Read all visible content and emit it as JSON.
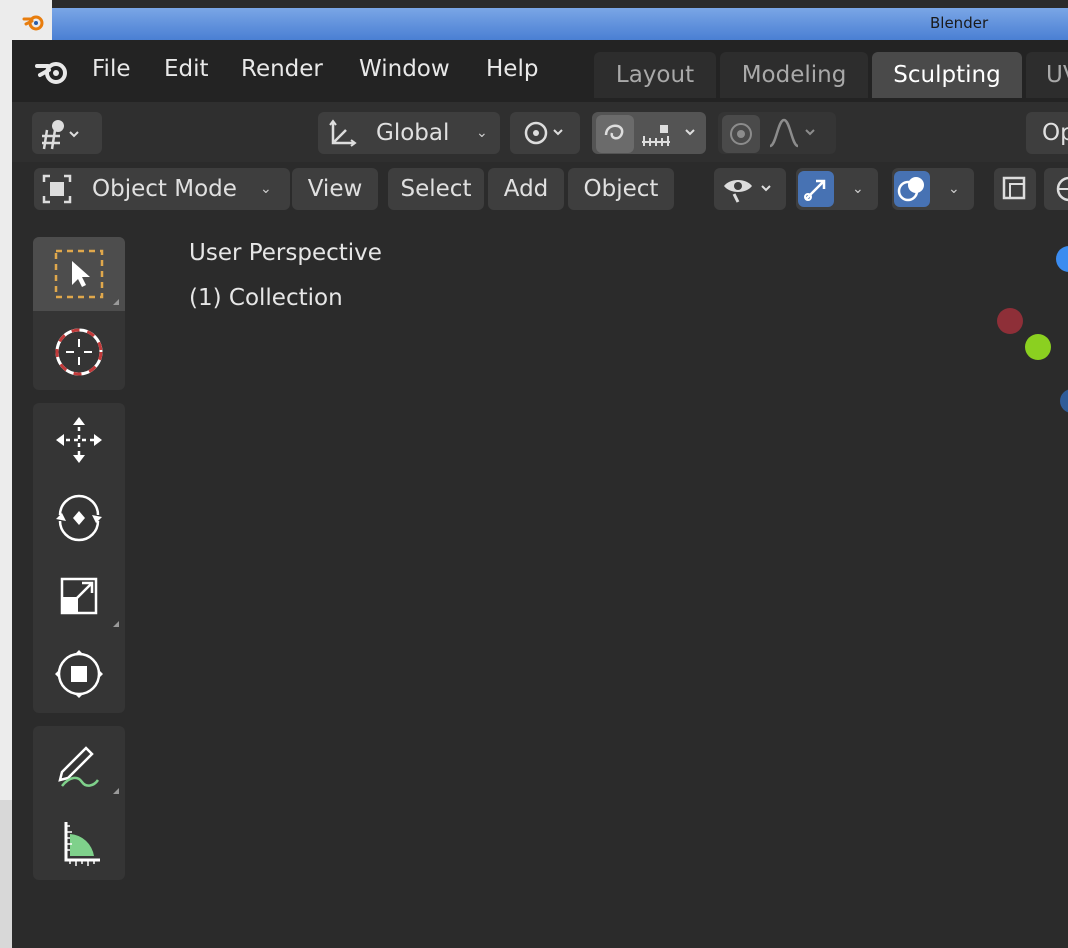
{
  "window": {
    "title": "Blender"
  },
  "menu": [
    "File",
    "Edit",
    "Render",
    "Window",
    "Help"
  ],
  "workspace_tabs": [
    {
      "label": "Layout",
      "active": false
    },
    {
      "label": "Modeling",
      "active": false
    },
    {
      "label": "Sculpting",
      "active": true
    },
    {
      "label": "UV",
      "active": false
    }
  ],
  "toolbar": {
    "transform_orientation": "Global",
    "options_label": "Op"
  },
  "viewport_header": {
    "mode": "Object Mode",
    "menus": [
      "View",
      "Select",
      "Add",
      "Object"
    ]
  },
  "viewport": {
    "perspective_label": "User Perspective",
    "collection_label": "(1) Collection"
  },
  "icons": [
    "blender-logo-icon",
    "snap-icon",
    "transform-orientation-icon",
    "pivot-icon",
    "proportional-editing-icon",
    "measure-ruler-icon",
    "falloff-curve-icon",
    "object-mode-icon",
    "visibility-icon",
    "gizmo-icon",
    "overlay-icon",
    "xray-icon",
    "select-box-icon",
    "cursor-icon",
    "move-icon",
    "rotate-icon",
    "scale-icon",
    "transform-icon",
    "annotate-icon",
    "measure-icon"
  ],
  "colors": {
    "accent": "#4772b3",
    "viewport_bg": "#2b2b2b",
    "header_bg": "#2f2f2f",
    "topbar_bg": "#232323"
  }
}
